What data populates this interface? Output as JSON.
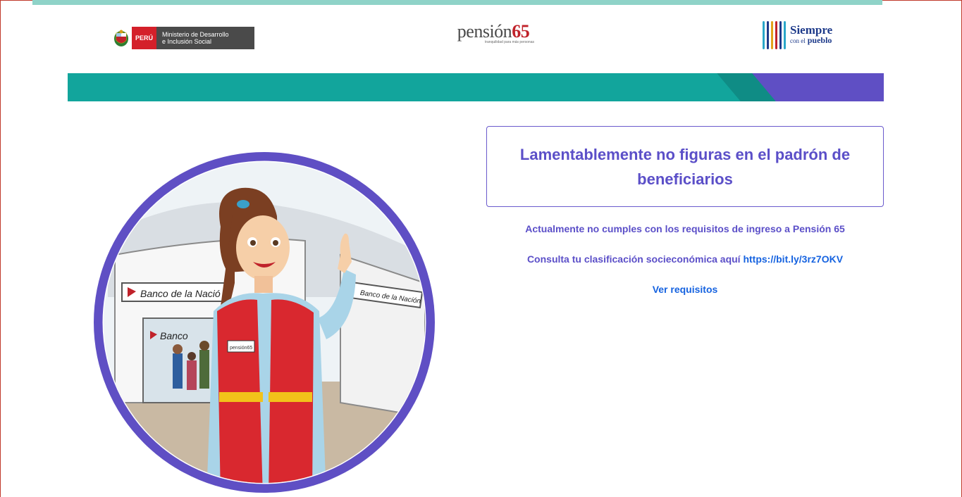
{
  "header": {
    "peru_label": "PERÚ",
    "ministry_line1": "Ministerio de Desarrollo",
    "ministry_line2": "e Inclusión Social",
    "p65_word": "pensión",
    "p65_number": "65",
    "p65_tagline": "tranquilidad para más personas",
    "siempre_big": "Siempre",
    "siempre_small_prefix": "con el",
    "siempre_small": "pueblo"
  },
  "illustration": {
    "bank_sign_left": "Banco de la Nació",
    "bank_sign_right": "Banco de la Nación",
    "bank_sign_lower": "Banco",
    "vest_badge": "pensión65"
  },
  "message": {
    "title": "Lamentablemente no figuras en el padrón de beneficiarios",
    "line1": "Actualmente no cumples con los requisitos de ingreso a Pensión 65",
    "line2_prefix": "Consulta tu clasificación socieconómica aquí",
    "line2_link": "https://bit.ly/3rz7OKV",
    "requirements_link": "Ver requisitos"
  },
  "colors": {
    "accent_teal": "#12a59c",
    "accent_purple": "#5f4fc4",
    "link_blue": "#1663e0",
    "peru_red": "#d4202a"
  }
}
